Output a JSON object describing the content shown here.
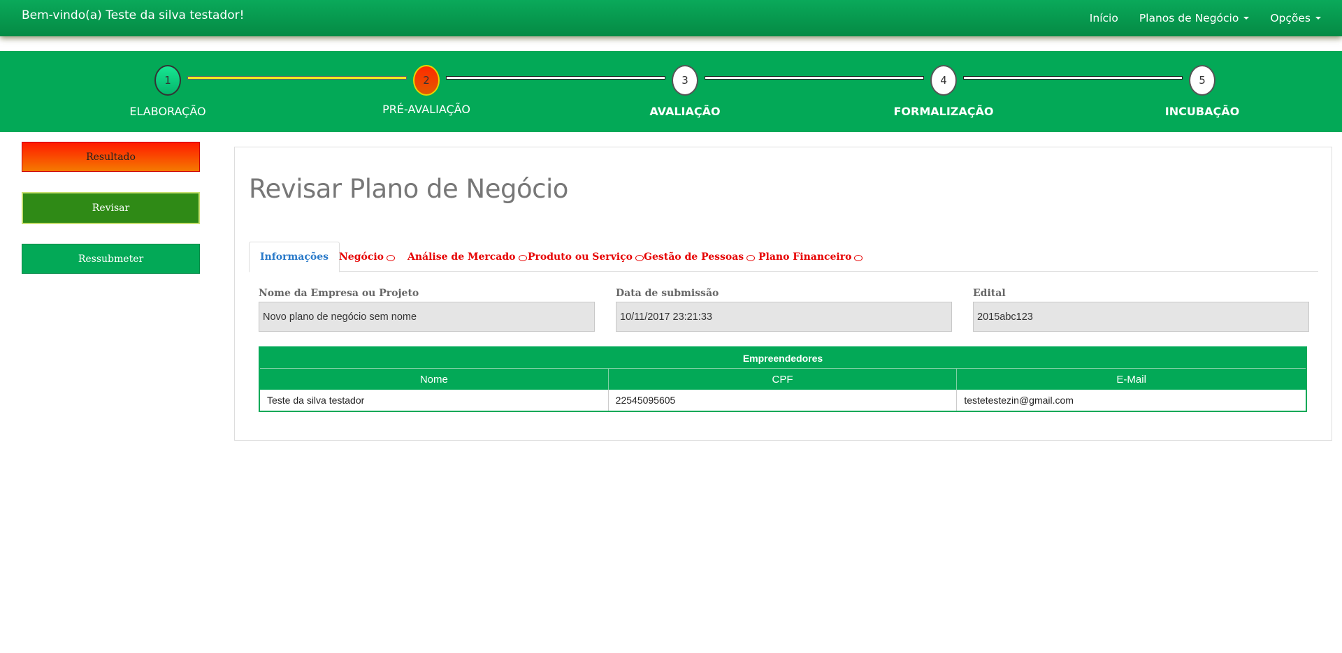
{
  "navbar": {
    "welcome": "Bem-vindo(a) Teste da silva testador!",
    "menu": [
      "Início",
      "Planos de Negócio",
      "Opções"
    ]
  },
  "steps": [
    {
      "number": "1",
      "label": "ELABORAÇÃO",
      "status": "done"
    },
    {
      "number": "2",
      "label": "PRÉ-AVALIAÇÃO",
      "status": "current"
    },
    {
      "number": "3",
      "label": "AVALIAÇÃO",
      "status": "pending"
    },
    {
      "number": "4",
      "label": "FORMALIZAÇÃO",
      "status": "pending"
    },
    {
      "number": "5",
      "label": "INCUBAÇÃO",
      "status": "pending"
    }
  ],
  "sidebar": {
    "resultado": "Resultado",
    "revisar": "Revisar",
    "ressubmeter": "Ressubmeter"
  },
  "main": {
    "title": "Revisar Plano de Negócio",
    "tabs": [
      {
        "label": "Informações",
        "active": true
      },
      {
        "label": "Negócio",
        "comment": true
      },
      {
        "label": "Análise de Mercado",
        "comment": true
      },
      {
        "label": "Produto ou Serviço",
        "comment": true
      },
      {
        "label": "Gestão de Pessoas",
        "comment": true
      },
      {
        "label": "Plano Financeiro",
        "comment": true
      }
    ],
    "fields": [
      {
        "label": "Nome da Empresa ou Projeto",
        "value": "Novo plano de negócio sem nome"
      },
      {
        "label": "Data de submissão",
        "value": "10/11/2017 23:21:33"
      },
      {
        "label": "Edital",
        "value": "2015abc123"
      }
    ],
    "table": {
      "caption": "Empreendedores",
      "headers": [
        "Nome",
        "CPF",
        "E-Mail"
      ],
      "rows": [
        [
          "Teste da silva testador",
          "22545095605",
          "testetestezin@gmail.com"
        ]
      ]
    }
  },
  "colors": {
    "brand_green": "#03a957",
    "alert_red": "#e60000",
    "active_tab_blue": "#2a7ac9"
  }
}
